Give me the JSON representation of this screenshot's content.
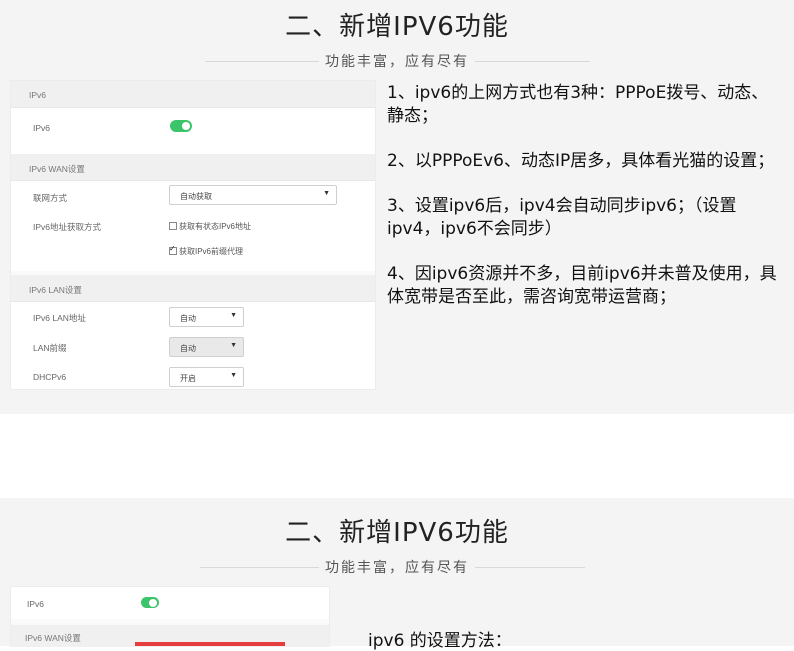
{
  "section1": {
    "title": "二、新增IPV6功能",
    "subtitle": "功能丰富，应有尽有"
  },
  "settings1": {
    "ipv6_header": "IPv6",
    "ipv6_label": "IPv6",
    "ipv6_enabled": true,
    "wan_header": "IPv6 WAN设置",
    "conn_label": "联网方式",
    "conn_value": "自动获取",
    "addr_label": "IPv6地址获取方式",
    "check1_label": "获取有状态IPv6地址",
    "check1_checked": false,
    "check2_label": "获取IPv6前缀代理",
    "check2_checked": true,
    "lan_header": "IPv6 LAN设置",
    "lan_addr_label": "IPv6 LAN地址",
    "lan_addr_value": "自动",
    "prefix_label": "LAN前缀",
    "prefix_value": "自动",
    "dhcp_label": "DHCPv6",
    "dhcp_value": "开启"
  },
  "notes": [
    "1、ipv6的上网方式也有3种：PPPoE拨号、动态、静态；",
    "2、以PPPoEv6、动态IP居多，具体看光猫的设置；",
    "3、设置ipv6后，ipv4会自动同步ipv6；（设置ipv4，ipv6不会同步）",
    "4、因ipv6资源并不多，目前ipv6并未普及使用，具体宽带是否至此，需咨询宽带运营商；"
  ],
  "section2": {
    "title": "二、新增IPV6功能",
    "subtitle": "功能丰富，应有尽有"
  },
  "settings2": {
    "ipv6_label": "IPv6",
    "ipv6_enabled": true,
    "wan_header": "IPv6 WAN设置"
  },
  "method_text": "ipv6 的设置方法：",
  "colors": {
    "toggle_on": "#3cc46a",
    "accent_red": "#e63e3e",
    "panel_bg": "#f4f4f4"
  }
}
